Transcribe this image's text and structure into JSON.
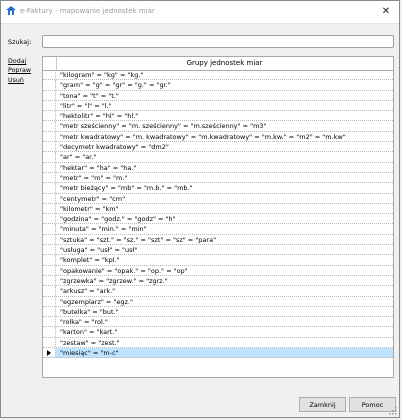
{
  "window": {
    "title": "e-Faktury - mapowanie jednostek miar",
    "close_symbol": "✕"
  },
  "search": {
    "label": "Szukaj:",
    "value": "",
    "placeholder": ""
  },
  "actions": {
    "add": "Dodaj",
    "edit": "Popraw",
    "delete": "Usuń"
  },
  "grid": {
    "header": "Grupy jednostek miar",
    "rows": [
      "\"kilogram\" = \"kg\" = \"kg.\"",
      "\"gram\" = \"g\" = \"gr\" = \"g.\" = \"gr.\"",
      "\"tona\" = \"t\" = \"t.\"",
      "\"litr\" = \"l\" = \"l.\"",
      "\"hektolitr\" = \"hl\" = \"hl.\"",
      "\"metr sześcienny\" = \"m. sześcienny\" = \"m.sześcienny\" = \"m3\"",
      "\"metr kwadratowy\" = \"m. kwadratowy\" = \"m.kwadratowy\" = \"m.kw.\" = \"m2\" = \"m.kw\"",
      "\"decymetr kwadratowy\" = \"dm2\"",
      "\"ar\" = \"ar.\"",
      "\"hektar\" = \"ha\" = \"ha.\"",
      "\"metr\" = \"m\" = \"m.\"",
      "\"metr bieżący\" = \"mb\" = \"m.b.\" = \"mb.\"",
      "\"centymetr\" = \"cm\"",
      "\"kilometr\" = \"km\"",
      "\"godzina\" = \"godz.\" = \"godz\" = \"h\"",
      "\"minuta\" = \"min.\" = \"min\"",
      "\"sztuka\" = \"szt.\" = \"sz.\" = \"szt\" = \"sz\" = \"para\"",
      "\"usługa\" = \"usł\" = \"usł\"",
      "\"komplet\" = \"kpl.\"",
      "\"opakowanie\" = \"opak.\" = \"op.\" = \"op\"",
      "\"zgrzewka\" = \"zgrzew.\" = \"zgrz.\"",
      "\"arkusz\" = \"ark.\"",
      "\"egzemplarz\" = \"egz.\"",
      "\"butelka\" = \"but.\"",
      "\"rolka\" = \"rol.\"",
      "\"karton\" = \"kart.\"",
      "\"zestaw\" = \"zest.\"",
      "\"miesiąc\" = \"m-c\""
    ],
    "selected_index": 27
  },
  "buttons": {
    "ok": "Zamknij",
    "help": "Pomoc"
  },
  "colors": {
    "selection": "#bfe2ff",
    "window_bg": "#f0f0f0"
  }
}
